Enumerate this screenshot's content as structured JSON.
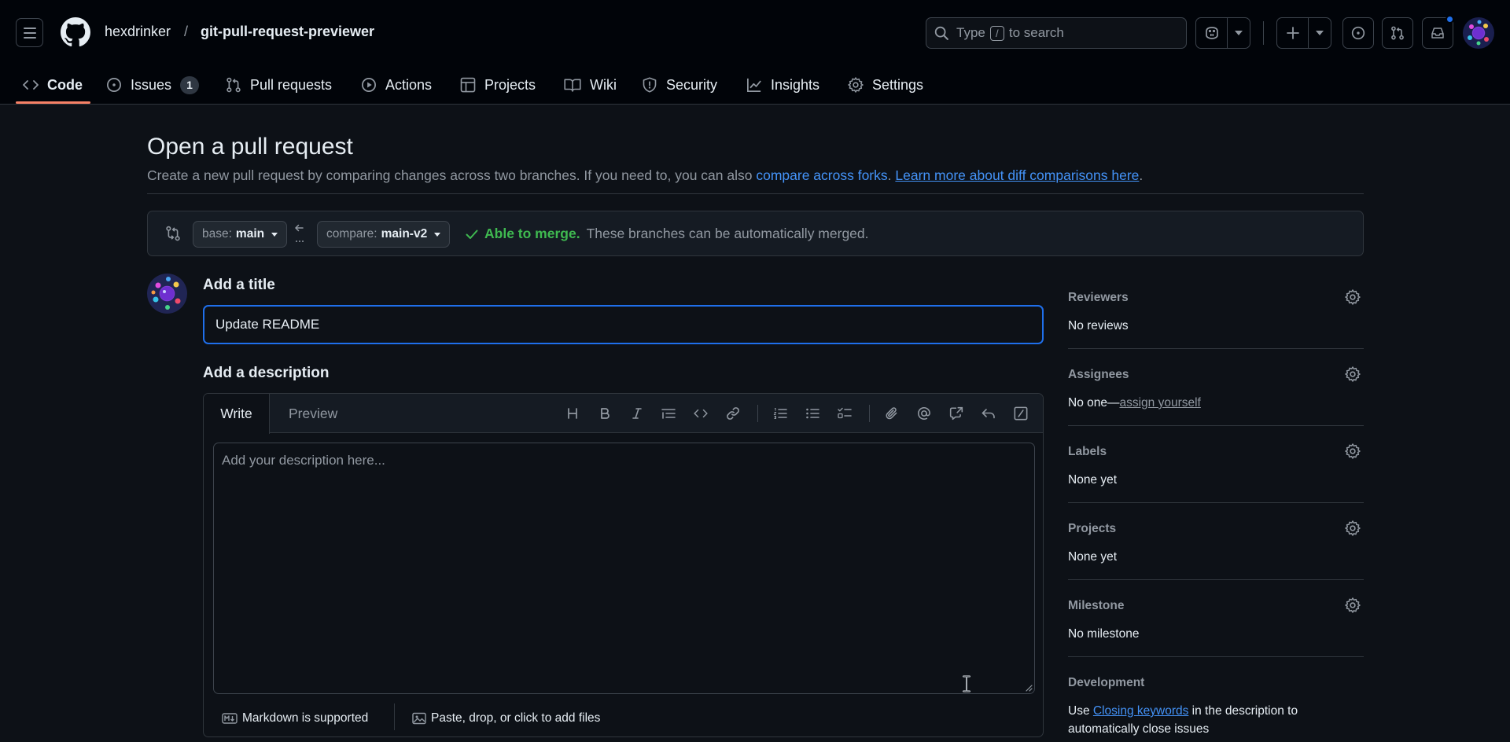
{
  "header": {
    "repo_owner": "hexdrinker",
    "repo_separator": "/",
    "repo_name": "git-pull-request-previewer",
    "search": {
      "prefix": "Type",
      "key": "/",
      "suffix": "to search"
    },
    "colors": {
      "accent": "#1f6feb",
      "background": "#010409",
      "tab_underline": "#f78166"
    }
  },
  "nav": {
    "tabs": [
      {
        "label": "Code",
        "icon": "code-icon",
        "active": true
      },
      {
        "label": "Issues",
        "icon": "issue-opened-icon",
        "count": "1"
      },
      {
        "label": "Pull requests",
        "icon": "git-pull-request-icon"
      },
      {
        "label": "Actions",
        "icon": "play-icon"
      },
      {
        "label": "Projects",
        "icon": "table-icon"
      },
      {
        "label": "Wiki",
        "icon": "book-icon"
      },
      {
        "label": "Security",
        "icon": "shield-icon"
      },
      {
        "label": "Insights",
        "icon": "graph-icon"
      },
      {
        "label": "Settings",
        "icon": "gear-icon"
      }
    ]
  },
  "page": {
    "title": "Open a pull request",
    "subtitle_text": "Create a new pull request by comparing changes across two branches. If you need to, you can also",
    "subtitle_link1": "compare across forks",
    "subtitle_period": ".",
    "subtitle_link2": "Learn more about diff comparisons here",
    "subtitle_end": "."
  },
  "compare": {
    "base_prefix": "base:",
    "base_branch": "main",
    "compare_prefix": "compare:",
    "compare_branch": "main-v2",
    "status_ok": "Able to merge.",
    "status_text": "These branches can be automatically merged.",
    "colors": {
      "ok": "#3fb950"
    }
  },
  "form": {
    "title_label": "Add a title",
    "title_value": "Update README",
    "description_label": "Add a description",
    "tab_write": "Write",
    "tab_preview": "Preview",
    "description_placeholder": "Add your description here...",
    "markdown_note": "Markdown is supported",
    "attach_note": "Paste, drop, or click to add files",
    "toolbar": [
      "heading-icon",
      "bold-icon",
      "italic-icon",
      "quote-icon",
      "code-icon",
      "link-icon",
      "ordered-list-icon",
      "unordered-list-icon",
      "task-list-icon",
      "paperclip-icon",
      "mention-icon",
      "cross-reference-icon",
      "reply-icon",
      "slash-command-icon"
    ]
  },
  "sidebar": {
    "reviewers": {
      "label": "Reviewers",
      "value": "No reviews"
    },
    "assignees": {
      "label": "Assignees",
      "value": "No one—",
      "link": "assign yourself"
    },
    "labels": {
      "label": "Labels",
      "value": "None yet"
    },
    "projects": {
      "label": "Projects",
      "value": "None yet"
    },
    "milestone": {
      "label": "Milestone",
      "value": "No milestone"
    },
    "development": {
      "label": "Development",
      "pre": "Use",
      "link": "Closing keywords",
      "post": "in the description to automatically close issues"
    }
  }
}
